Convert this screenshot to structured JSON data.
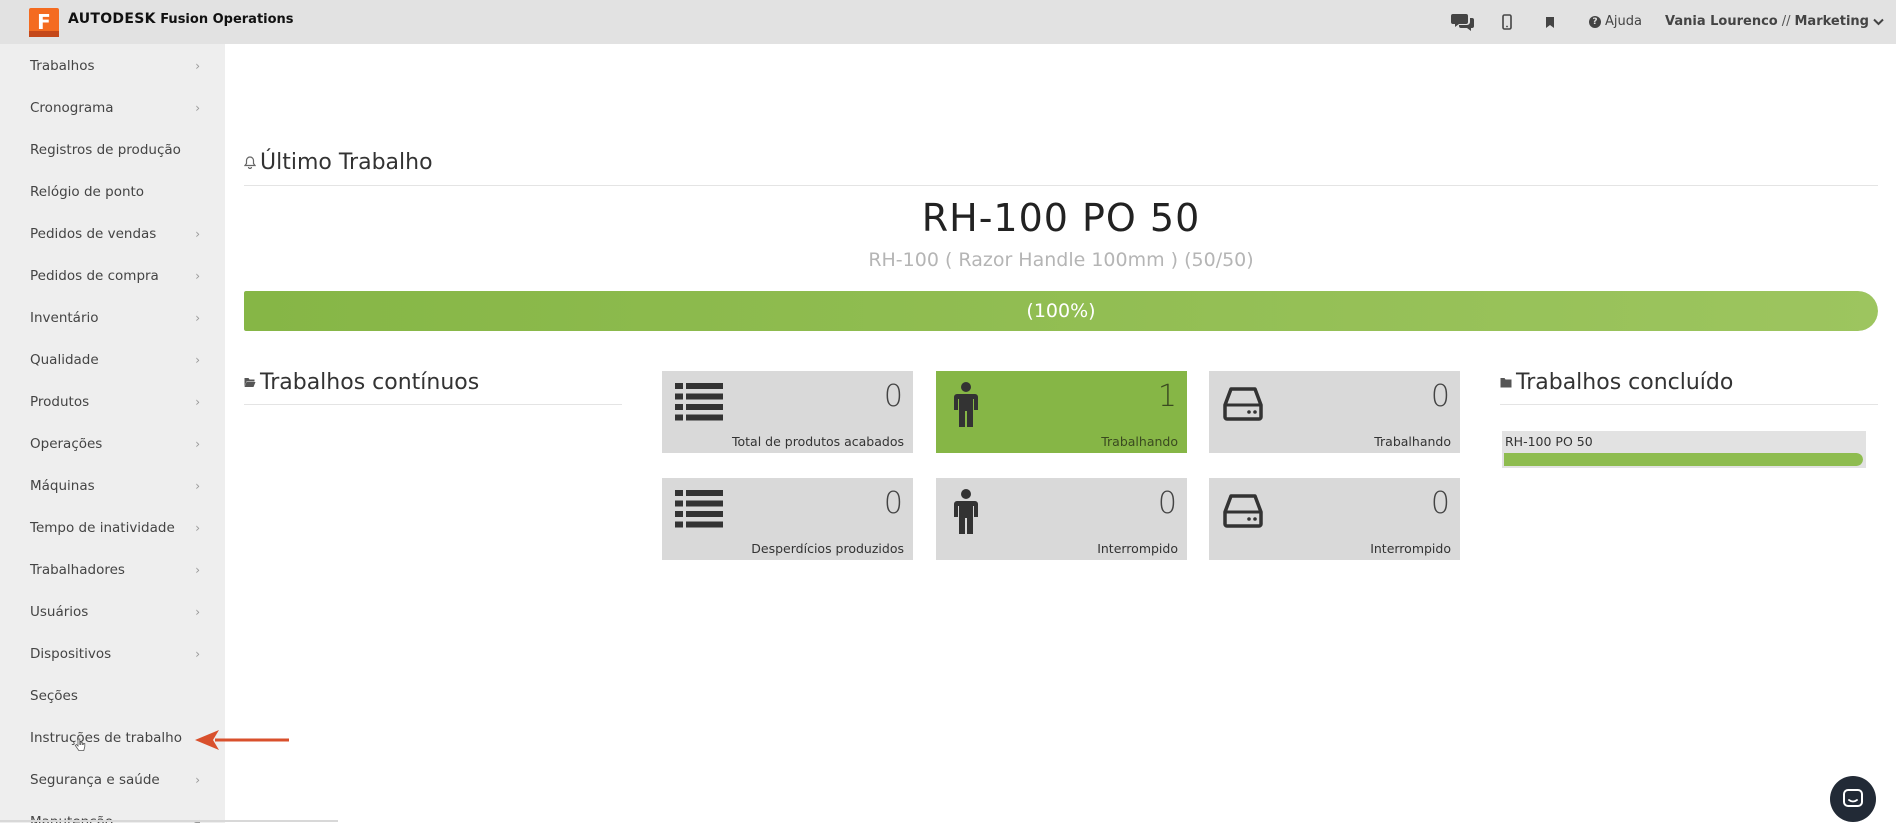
{
  "header": {
    "logo_letter": "F",
    "brand_main": "AUTODESK",
    "brand_product": "Fusion Operations",
    "help_label": "Ajuda",
    "user_name": "Vania Lourenco",
    "user_sep": "//",
    "user_dept": "Marketing",
    "icons": [
      "chat-icon",
      "mobile-icon",
      "bookmark-icon",
      "help-icon",
      "chevron-down-icon"
    ]
  },
  "sidebar": {
    "items": [
      {
        "label": "Trabalhos",
        "has_submenu": true
      },
      {
        "label": "Cronograma",
        "has_submenu": true
      },
      {
        "label": "Registros de produção",
        "has_submenu": false
      },
      {
        "label": "Relógio de ponto",
        "has_submenu": false
      },
      {
        "label": "Pedidos de vendas",
        "has_submenu": true
      },
      {
        "label": "Pedidos de compra",
        "has_submenu": true
      },
      {
        "label": "Inventário",
        "has_submenu": true
      },
      {
        "label": "Qualidade",
        "has_submenu": true
      },
      {
        "label": "Produtos",
        "has_submenu": true
      },
      {
        "label": "Operações",
        "has_submenu": true
      },
      {
        "label": "Máquinas",
        "has_submenu": true
      },
      {
        "label": "Tempo de inatividade",
        "has_submenu": true
      },
      {
        "label": "Trabalhadores",
        "has_submenu": true
      },
      {
        "label": "Usuários",
        "has_submenu": true
      },
      {
        "label": "Dispositivos",
        "has_submenu": true
      },
      {
        "label": "Seções",
        "has_submenu": false
      },
      {
        "label": "Instruções de trabalho",
        "has_submenu": false
      },
      {
        "label": "Segurança e saúde",
        "has_submenu": true
      },
      {
        "label": "Manutenção",
        "has_submenu": true
      }
    ]
  },
  "last_job": {
    "section_title": "Último Trabalho",
    "title": "RH-100 PO 50",
    "subtitle": "RH-100 ( Razor Handle 100mm ) (50/50)",
    "progress_label": "(100%)",
    "progress_percent": 100
  },
  "continuous": {
    "section_title": "Trabalhos contínuos"
  },
  "stats": [
    {
      "value": "0",
      "label": "Total de produtos acabados",
      "icon": "list-icon",
      "highlight": false
    },
    {
      "value": "1",
      "label": "Trabalhando",
      "icon": "person-icon",
      "highlight": true
    },
    {
      "value": "0",
      "label": "Trabalhando",
      "icon": "hard-drive-icon",
      "highlight": false
    },
    {
      "value": "0",
      "label": "Desperdícios produzidos",
      "icon": "list-icon",
      "highlight": false
    },
    {
      "value": "0",
      "label": "Interrompido",
      "icon": "person-icon",
      "highlight": false
    },
    {
      "value": "0",
      "label": "Interrompido",
      "icon": "hard-drive-icon",
      "highlight": false
    }
  ],
  "completed": {
    "section_title": "Trabalhos concluído",
    "items": [
      {
        "name": "RH-100 PO 50",
        "progress_percent": 100
      }
    ]
  },
  "colors": {
    "accent_green": "#86b646",
    "brand_orange": "#f46b20",
    "annotation_arrow": "#d9502c"
  }
}
